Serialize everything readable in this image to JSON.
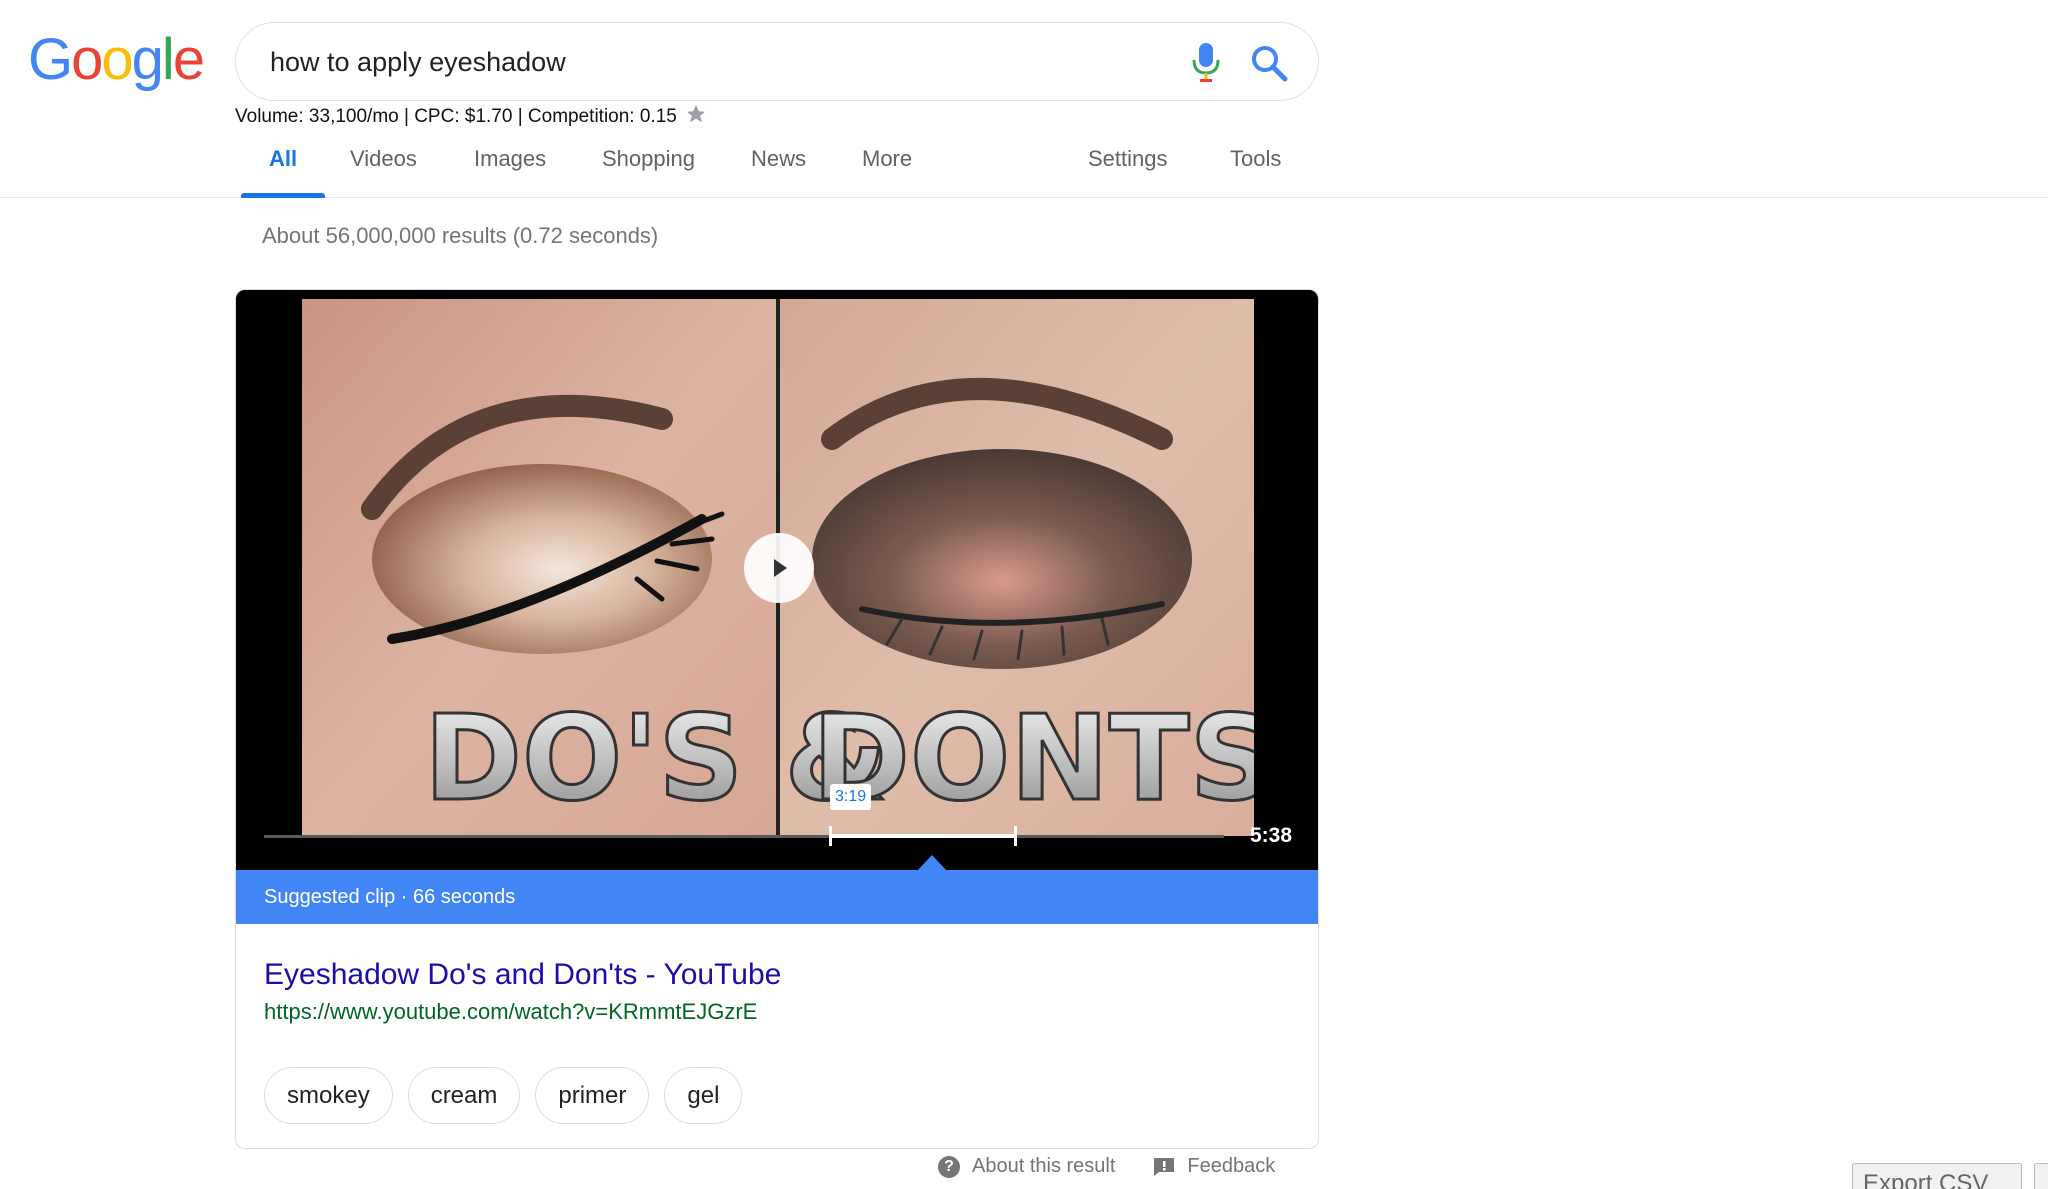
{
  "logo": {
    "letters": [
      "G",
      "o",
      "o",
      "g",
      "l",
      "e"
    ],
    "colors": [
      "#4285f4",
      "#ea4335",
      "#fbbc05",
      "#4285f4",
      "#34a853",
      "#ea4335"
    ]
  },
  "search": {
    "query": "how to apply eyeshadow"
  },
  "seo_bar": {
    "text": "Volume: 33,100/mo | CPC: $1.70 | Competition: 0.15"
  },
  "tabs": [
    {
      "label": "All",
      "active": true
    },
    {
      "label": "Videos"
    },
    {
      "label": "Images"
    },
    {
      "label": "Shopping"
    },
    {
      "label": "News"
    },
    {
      "label": "More"
    },
    {
      "label": "Settings"
    },
    {
      "label": "Tools"
    }
  ],
  "stats": "About 56,000,000 results (0.72 seconds)",
  "video": {
    "overlay_left": "DO'S &",
    "overlay_right": "DONTS",
    "clip_start": "3:19",
    "duration": "5:38",
    "clip_fraction": {
      "start": 0.59,
      "end": 0.78
    }
  },
  "suggested_clip": "Suggested clip · 66 seconds",
  "result": {
    "title": "Eyeshadow Do's and Don'ts - YouTube",
    "url": "https://www.youtube.com/watch?v=KRmmtEJGzrE"
  },
  "chips": [
    "smokey",
    "cream",
    "primer",
    "gel"
  ],
  "footer": {
    "about": "About this result",
    "feedback": "Feedback"
  },
  "export": {
    "label": "Export CSV"
  },
  "colors": {
    "accent": "#1a73e8",
    "banner": "#4285f4",
    "link": "#1a0dab",
    "url": "#006621"
  }
}
